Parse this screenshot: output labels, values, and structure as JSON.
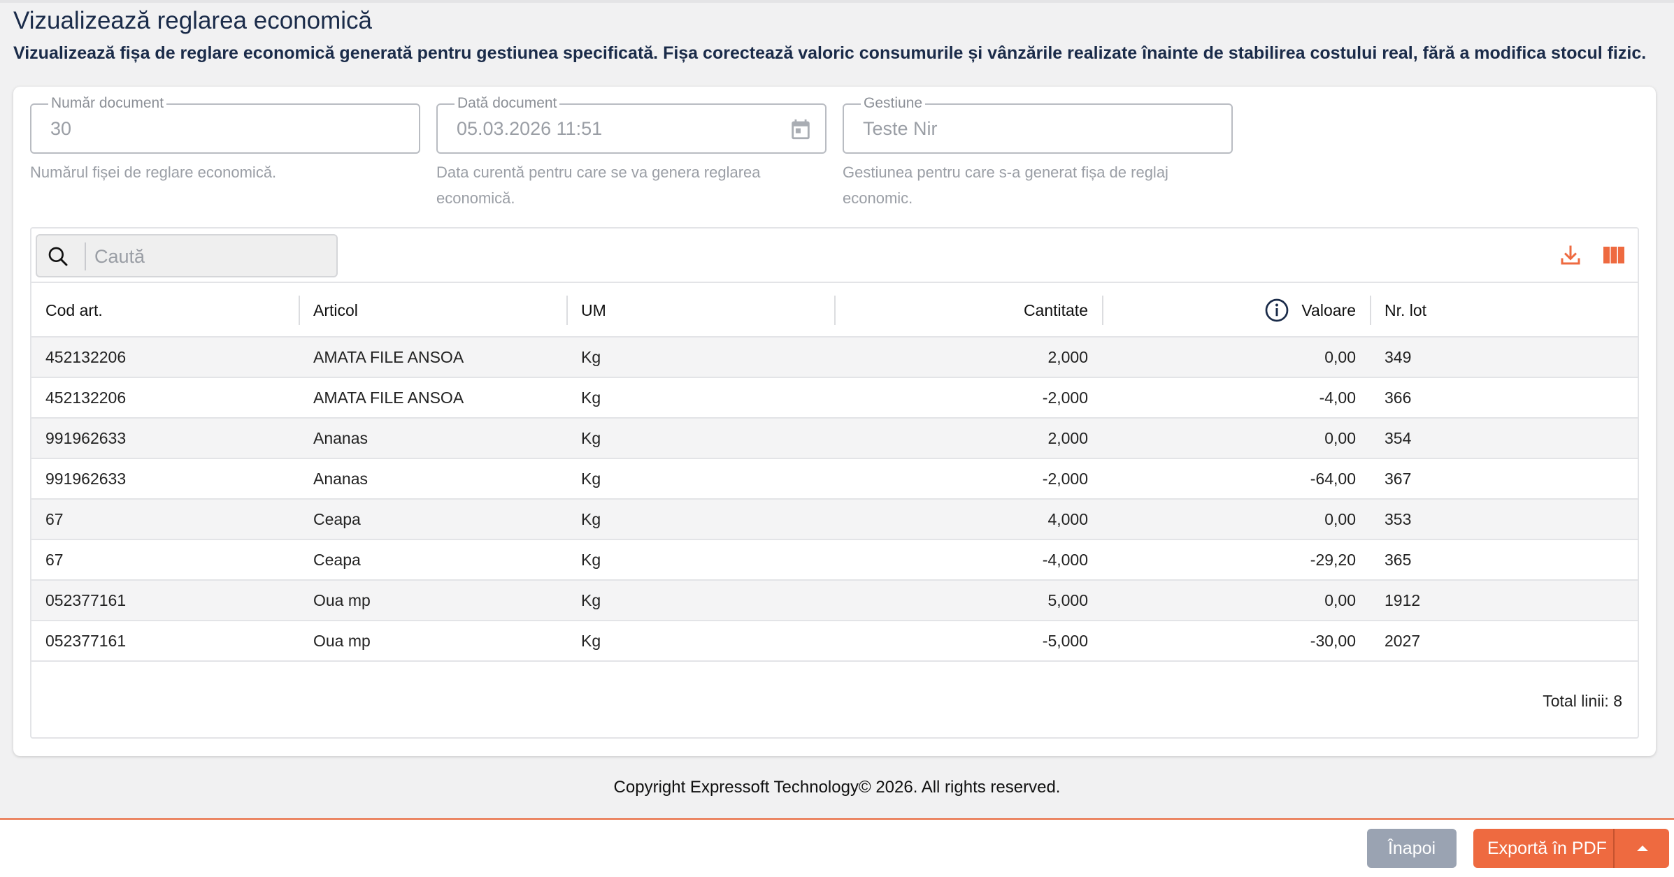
{
  "page": {
    "title": "Vizualizează reglarea economică",
    "description": "Vizualizează fișa de reglare economică generată pentru gestiunea specificată. Fișa corectează valoric consumurile și vânzările realizate înainte de stabilirea costului real, fără a modifica stocul fizic."
  },
  "form": {
    "document_number": {
      "label": "Număr document",
      "value": "30",
      "helper": "Numărul fișei de reglare economică."
    },
    "document_date": {
      "label": "Dată document",
      "value": "05.03.2026 11:51",
      "helper": "Data curentă pentru care se va genera reglarea economică."
    },
    "warehouse": {
      "label": "Gestiune",
      "value": "Teste Nir",
      "helper": "Gestiunea pentru care s-a generat fișa de reglaj economic."
    }
  },
  "search": {
    "placeholder": "Caută"
  },
  "table": {
    "columns": {
      "code": "Cod art.",
      "article": "Articol",
      "um": "UM",
      "quantity": "Cantitate",
      "value": "Valoare",
      "lot": "Nr. lot"
    },
    "rows": [
      {
        "code": "452132206",
        "article": "AMATA FILE ANSOA",
        "um": "Kg",
        "quantity": "2,000",
        "value": "0,00",
        "lot": "349"
      },
      {
        "code": "452132206",
        "article": "AMATA FILE ANSOA",
        "um": "Kg",
        "quantity": "-2,000",
        "value": "-4,00",
        "lot": "366"
      },
      {
        "code": "991962633",
        "article": "Ananas",
        "um": "Kg",
        "quantity": "2,000",
        "value": "0,00",
        "lot": "354"
      },
      {
        "code": "991962633",
        "article": "Ananas",
        "um": "Kg",
        "quantity": "-2,000",
        "value": "-64,00",
        "lot": "367"
      },
      {
        "code": "67",
        "article": "Ceapa",
        "um": "Kg",
        "quantity": "4,000",
        "value": "0,00",
        "lot": "353"
      },
      {
        "code": "67",
        "article": "Ceapa",
        "um": "Kg",
        "quantity": "-4,000",
        "value": "-29,20",
        "lot": "365"
      },
      {
        "code": "052377161",
        "article": "Oua mp",
        "um": "Kg",
        "quantity": "5,000",
        "value": "0,00",
        "lot": "1912"
      },
      {
        "code": "052377161",
        "article": "Oua mp",
        "um": "Kg",
        "quantity": "-5,000",
        "value": "-30,00",
        "lot": "2027"
      }
    ],
    "total": "Total linii: 8"
  },
  "footer": {
    "copyright": "Copyright Expressoft Technology© 2026. All rights reserved."
  },
  "actions": {
    "back": "Înapoi",
    "export_pdf": "Exportă în PDF"
  },
  "icons": {
    "calendar": "calendar-icon",
    "search": "search-icon",
    "download": "download-icon",
    "columns": "columns-icon",
    "info": "info-icon",
    "caret": "caret-up-icon"
  },
  "colors": {
    "accent": "#ee6a40",
    "title": "#1a2b49",
    "back_button": "#9aa3b2"
  }
}
